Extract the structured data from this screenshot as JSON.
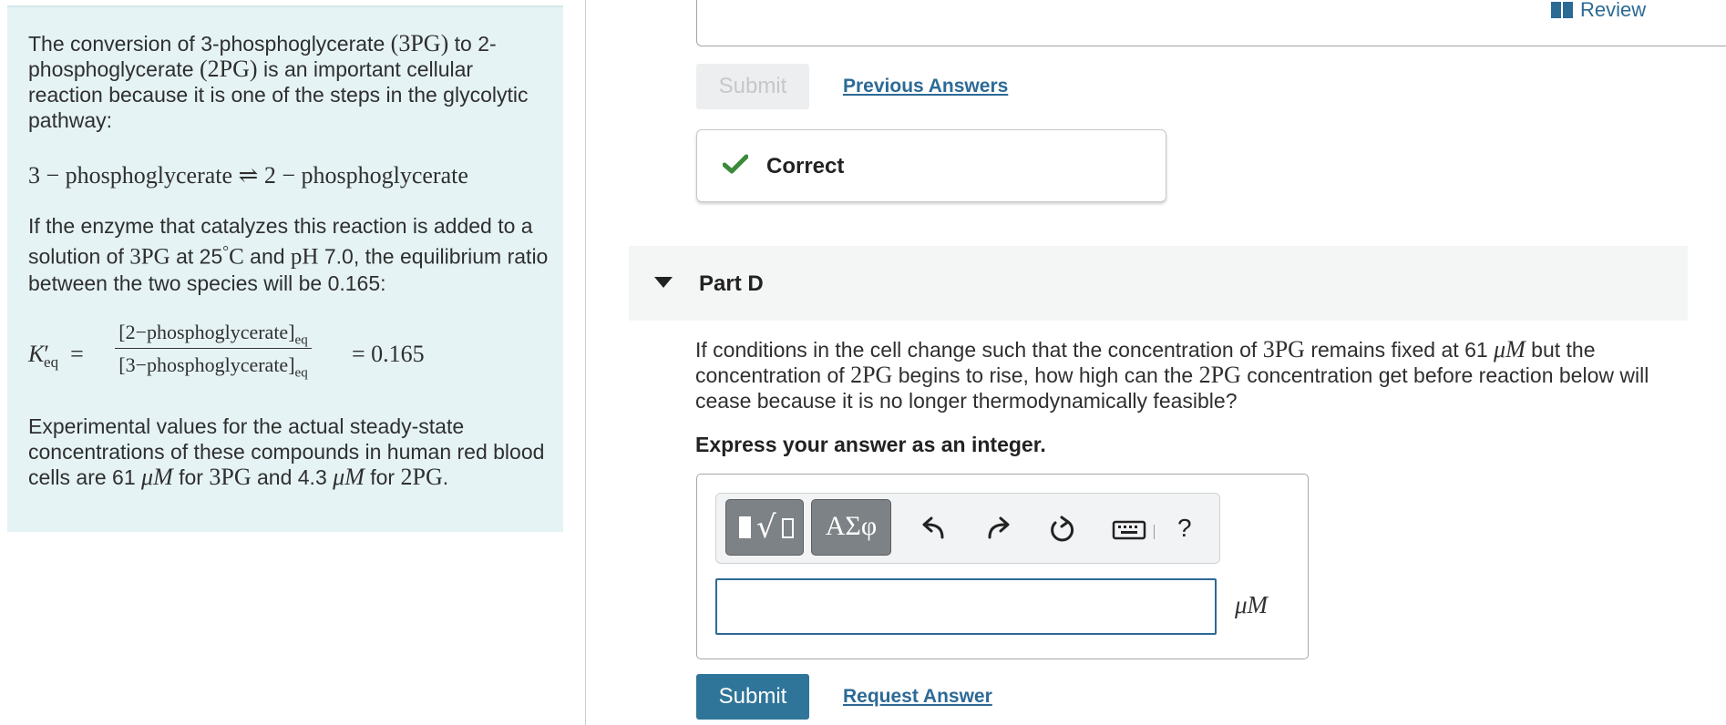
{
  "intro": {
    "p1": [
      "The conversion of 3-phosphoglycerate ",
      "(",
      "3PG",
      ")",
      " to 2-phosphoglycerate ",
      "(",
      "2PG",
      ")",
      " is an important cellular reaction because it is one of the steps in the glycolytic pathway:"
    ],
    "reaction": "3 − phosphoglycerate ⇌ 2 − phosphoglycerate",
    "p2": [
      "If the enzyme that catalyzes this reaction is added to a solution of ",
      "3PG",
      " at 25",
      "°",
      "C",
      " and ",
      "pH",
      " 7.0, the equilibrium ratio between the two species will be 0.165:"
    ],
    "keq": {
      "symbol": "K",
      "prime": "′",
      "sub": "eq",
      "equals": "=",
      "numerator": "[2−phosphoglycerate]",
      "denominator": "[3−phosphoglycerate]",
      "value": "= 0.165"
    },
    "p3": [
      "Experimental values for the actual steady-state concentrations of these compounds in human red blood cells are 61 ",
      "μM",
      " for ",
      "3PG",
      " and 4.3 ",
      "μM",
      " for ",
      "2PG",
      "."
    ]
  },
  "header": {
    "review_label": "Review"
  },
  "previous_part": {
    "submit_label": "Submit",
    "previous_answers_label": "Previous Answers",
    "feedback": "Correct"
  },
  "part": {
    "title": "Part D",
    "question": [
      "If conditions in the cell change such that the concentration of ",
      "3PG",
      " remains fixed at 61 ",
      "μM",
      " but the concentration of ",
      "2PG",
      " begins to rise, how high can the ",
      "2PG",
      " concentration get before reaction below will cease because it is no longer thermodynamically feasible?"
    ],
    "instruction": "Express your answer as an integer.",
    "toolbar": {
      "symbols_label": "ΑΣφ",
      "help_label": "?"
    },
    "answer_value": "",
    "unit": "μM",
    "submit_label": "Submit",
    "request_answer_label": "Request Answer"
  },
  "colors": {
    "accent": "#2f7599",
    "link": "#2c6a96",
    "intro_bg": "#e5f3f5",
    "check": "#3a8a3a"
  }
}
